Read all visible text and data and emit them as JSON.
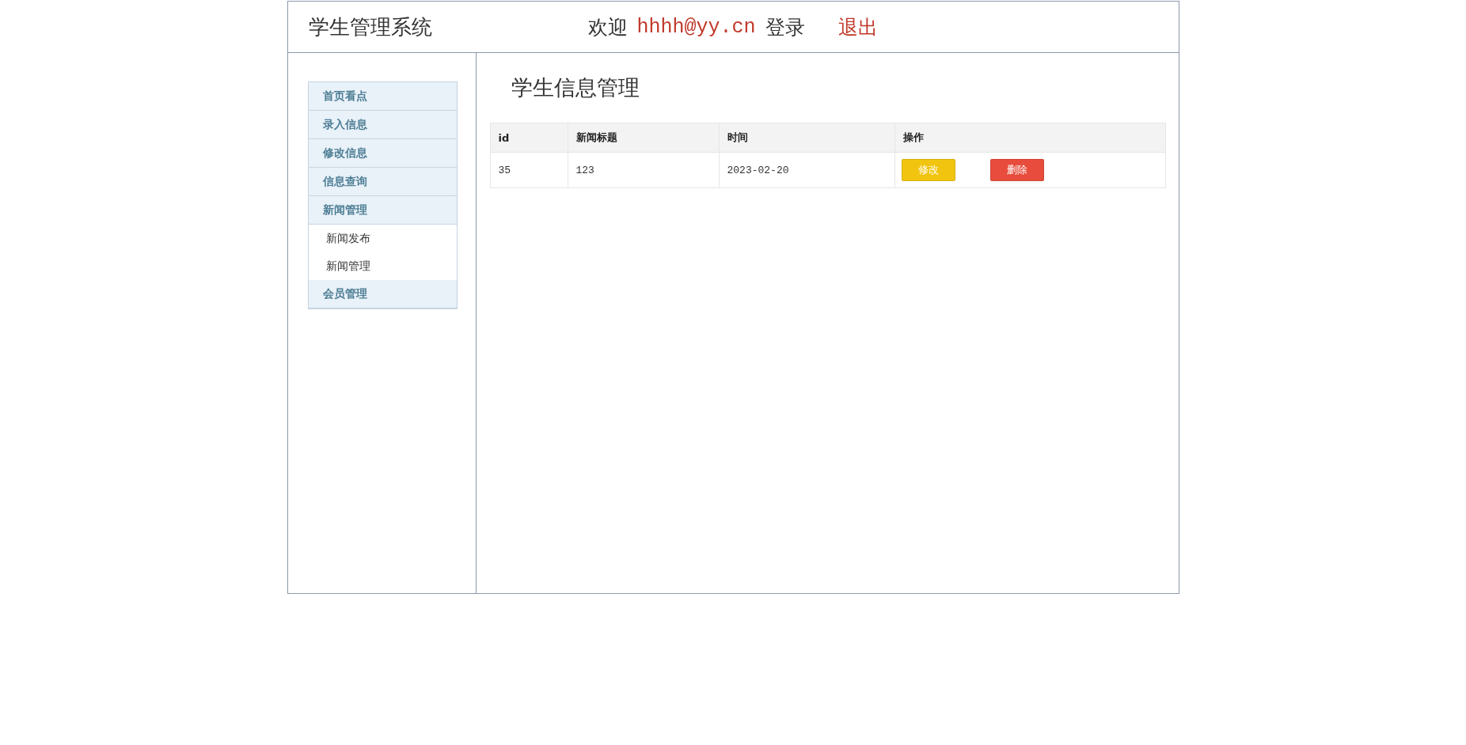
{
  "header": {
    "title": "学生管理系统",
    "welcome": "欢迎",
    "user": "hhhh@yy.cn",
    "login": "登录",
    "logout": "退出"
  },
  "sidebar": {
    "items": [
      {
        "label": "首页看点"
      },
      {
        "label": "录入信息"
      },
      {
        "label": "修改信息"
      },
      {
        "label": "信息查询"
      },
      {
        "label": "新闻管理",
        "children": [
          {
            "label": "新闻发布"
          },
          {
            "label": "新闻管理"
          }
        ]
      },
      {
        "label": "会员管理"
      }
    ]
  },
  "main": {
    "title": "学生信息管理",
    "table": {
      "columns": [
        "id",
        "新闻标题",
        "时间",
        "操作"
      ],
      "rows": [
        {
          "cells": [
            "35",
            "123",
            "2023-02-20"
          ],
          "actions": [
            {
              "label": "修改",
              "kind": "edit"
            },
            {
              "label": "删除",
              "kind": "delete"
            }
          ]
        }
      ]
    }
  }
}
